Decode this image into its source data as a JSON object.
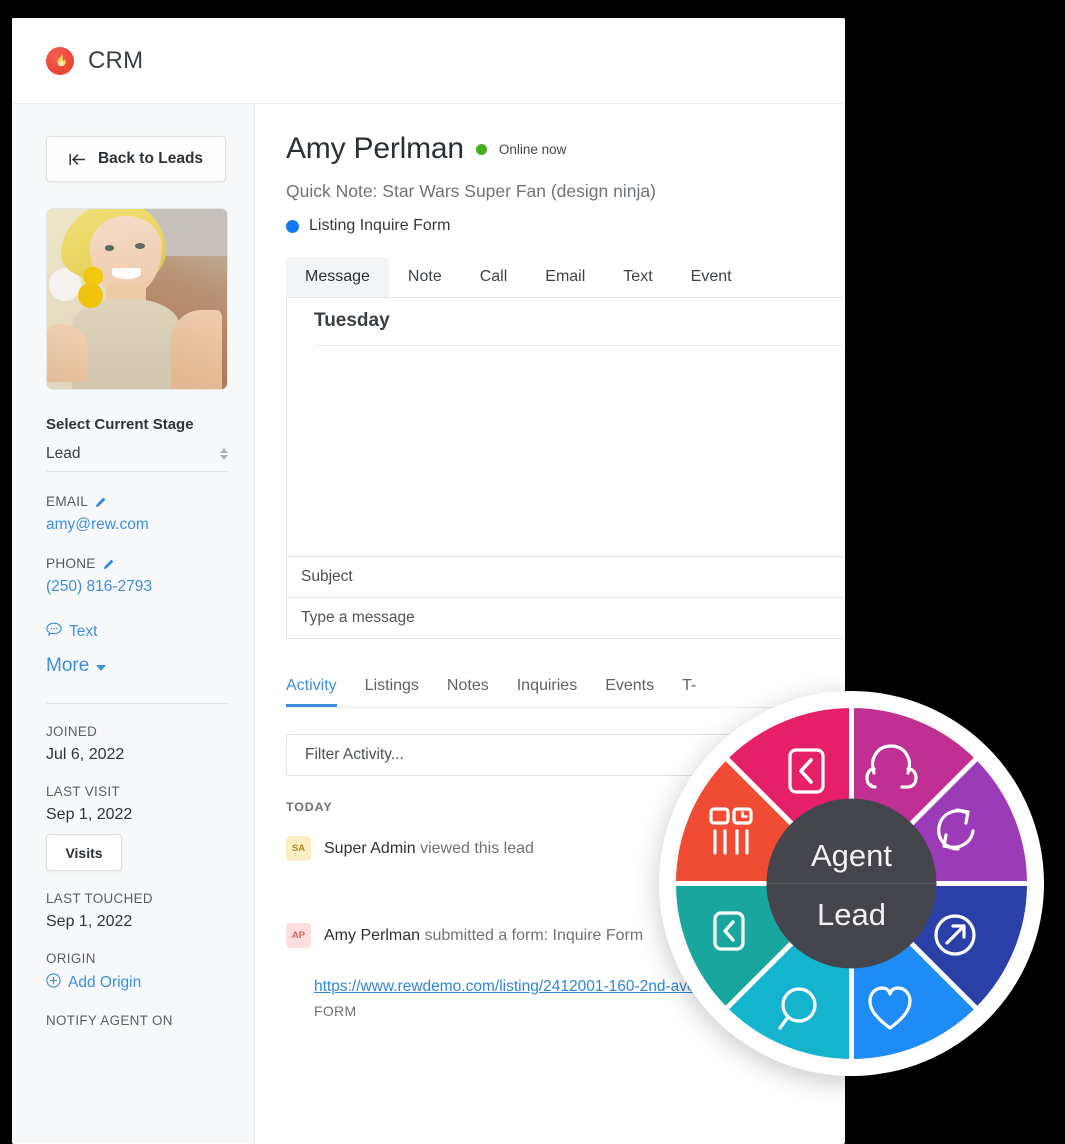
{
  "app": {
    "title": "CRM",
    "logo_icon": "flame-icon",
    "brand_color": "#ef4b3c"
  },
  "sidebar": {
    "back_button": "Back to Leads",
    "back_icon": "arrow-left-to-bar-icon",
    "avatar_alt": "Lead profile photo",
    "stage_heading": "Select Current Stage",
    "stage_value": "Lead",
    "email_label": "EMAIL",
    "email_value": "amy@rew.com",
    "phone_label": "PHONE",
    "phone_value": "(250) 816-2793",
    "text_link": "Text",
    "text_icon": "chat-bubble-icon",
    "more_link": "More",
    "joined_label": "JOINED",
    "joined_value": "Jul 6, 2022",
    "last_visit_label": "LAST VISIT",
    "last_visit_value": "Sep 1, 2022",
    "visits_button": "Visits",
    "last_touched_label": "LAST TOUCHED",
    "last_touched_value": "Sep 1, 2022",
    "origin_label": "ORIGIN",
    "add_origin": "Add Origin",
    "add_origin_icon": "plus-circle-icon",
    "notify_label": "NOTIFY AGENT ON"
  },
  "main": {
    "lead_name": "Amy Perlman",
    "status_text": "Online now",
    "status_color": "#46ae20",
    "quick_note": "Quick Note: Star Wars Super Fan (design ninja)",
    "form_label": "Listing Inquire Form",
    "form_dot_color": "#1279f2",
    "composer": {
      "tabs": [
        {
          "label": "Message",
          "active": true
        },
        {
          "label": "Note",
          "active": false
        },
        {
          "label": "Call",
          "active": false
        },
        {
          "label": "Email",
          "active": false
        },
        {
          "label": "Text",
          "active": false
        },
        {
          "label": "Event",
          "active": false
        }
      ],
      "thread_day": "Tuesday",
      "subject_placeholder": "Subject",
      "message_placeholder": "Type a message"
    },
    "activity": {
      "tabs": [
        {
          "label": "Activity",
          "active": true
        },
        {
          "label": "Listings",
          "active": false
        },
        {
          "label": "Notes",
          "active": false
        },
        {
          "label": "Inquiries",
          "active": false
        },
        {
          "label": "Events",
          "active": false
        },
        {
          "label": "T-",
          "active": false
        }
      ],
      "filter_placeholder": "Filter Activity...",
      "group_label": "TODAY",
      "items": [
        {
          "initials": "SA",
          "actor": "Super Admin",
          "action": "viewed this lead",
          "badge": "sa"
        },
        {
          "initials": "AP",
          "actor": "Amy Perlman",
          "action": "submitted a form: Inquire Form",
          "badge": "ap"
        }
      ],
      "form_url": "https://www.rewdemo.com/listing/2412001-160-2nd-ave-s-4001-na",
      "form_caption": "FORM"
    }
  },
  "wheel": {
    "hub_top": "Agent",
    "hub_bottom": "Lead",
    "hub_color": "#44444c",
    "segments": [
      {
        "name": "inbound-message",
        "icon": "chevron-left-box-icon",
        "color": "#e51f68"
      },
      {
        "name": "headset-call",
        "icon": "headset-icon",
        "color": "#bf3092"
      },
      {
        "name": "call-cycle",
        "icon": "phone-rotate-icon",
        "color": "#9c3bb7"
      },
      {
        "name": "outbound-link",
        "icon": "arrow-up-right-circle-icon",
        "color": "#2b3fa8"
      },
      {
        "name": "favorite",
        "icon": "heart-icon",
        "color": "#1f8bf5"
      },
      {
        "name": "search",
        "icon": "magnifier-icon",
        "color": "#14b4cf"
      },
      {
        "name": "saved-message",
        "icon": "chevron-left-box-small-icon",
        "color": "#19a69f"
      },
      {
        "name": "reports",
        "icon": "bar-chart-icon",
        "color": "#f04b33"
      }
    ]
  }
}
